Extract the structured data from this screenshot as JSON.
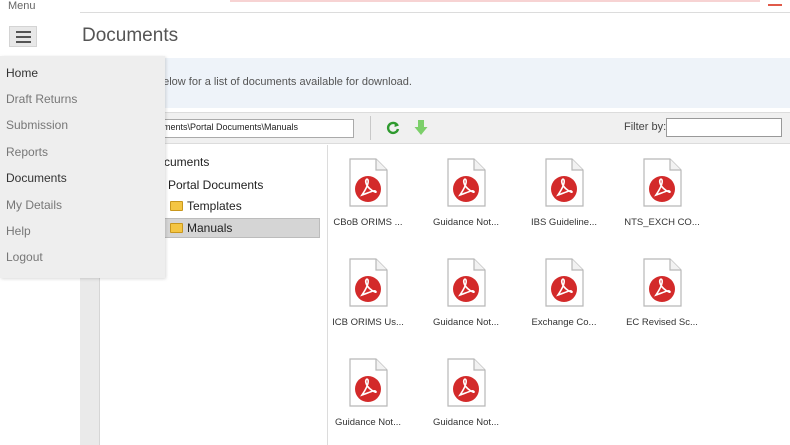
{
  "header": {
    "menu_label": "Menu",
    "page_title": "Documents"
  },
  "menu": {
    "items": [
      {
        "label": "Home"
      },
      {
        "label": "Draft Returns"
      },
      {
        "label": "Submission"
      },
      {
        "label": "Reports"
      },
      {
        "label": "Documents"
      },
      {
        "label": "My Details"
      },
      {
        "label": "Help"
      },
      {
        "label": "Logout"
      }
    ]
  },
  "info": {
    "text": "below for a list of documents available for download."
  },
  "toolbar": {
    "path_value": "iments\\Portal Documents\\Manuals",
    "refresh_icon": "refresh-icon",
    "download_icon": "download-arrow-icon",
    "filter_label": "Filter by:",
    "filter_value": ""
  },
  "tree": {
    "root": "cuments",
    "portal": "Portal Documents",
    "templates": "Templates",
    "manuals": "Manuals"
  },
  "files": [
    {
      "name": "CBoB ORIMS ..."
    },
    {
      "name": "Guidance Not..."
    },
    {
      "name": "IBS Guideline..."
    },
    {
      "name": "NTS_EXCH CO..."
    },
    {
      "name": "ICB ORIMS Us..."
    },
    {
      "name": "Guidance Not..."
    },
    {
      "name": "Exchange Co..."
    },
    {
      "name": "EC Revised Sc..."
    },
    {
      "name": "Guidance Not..."
    },
    {
      "name": "Guidance Not..."
    }
  ],
  "colors": {
    "accent_red": "#d41d1d",
    "refresh_green": "#2f9a2f",
    "download_green": "#7ccf6a",
    "menu_bg": "#eeeeee"
  }
}
